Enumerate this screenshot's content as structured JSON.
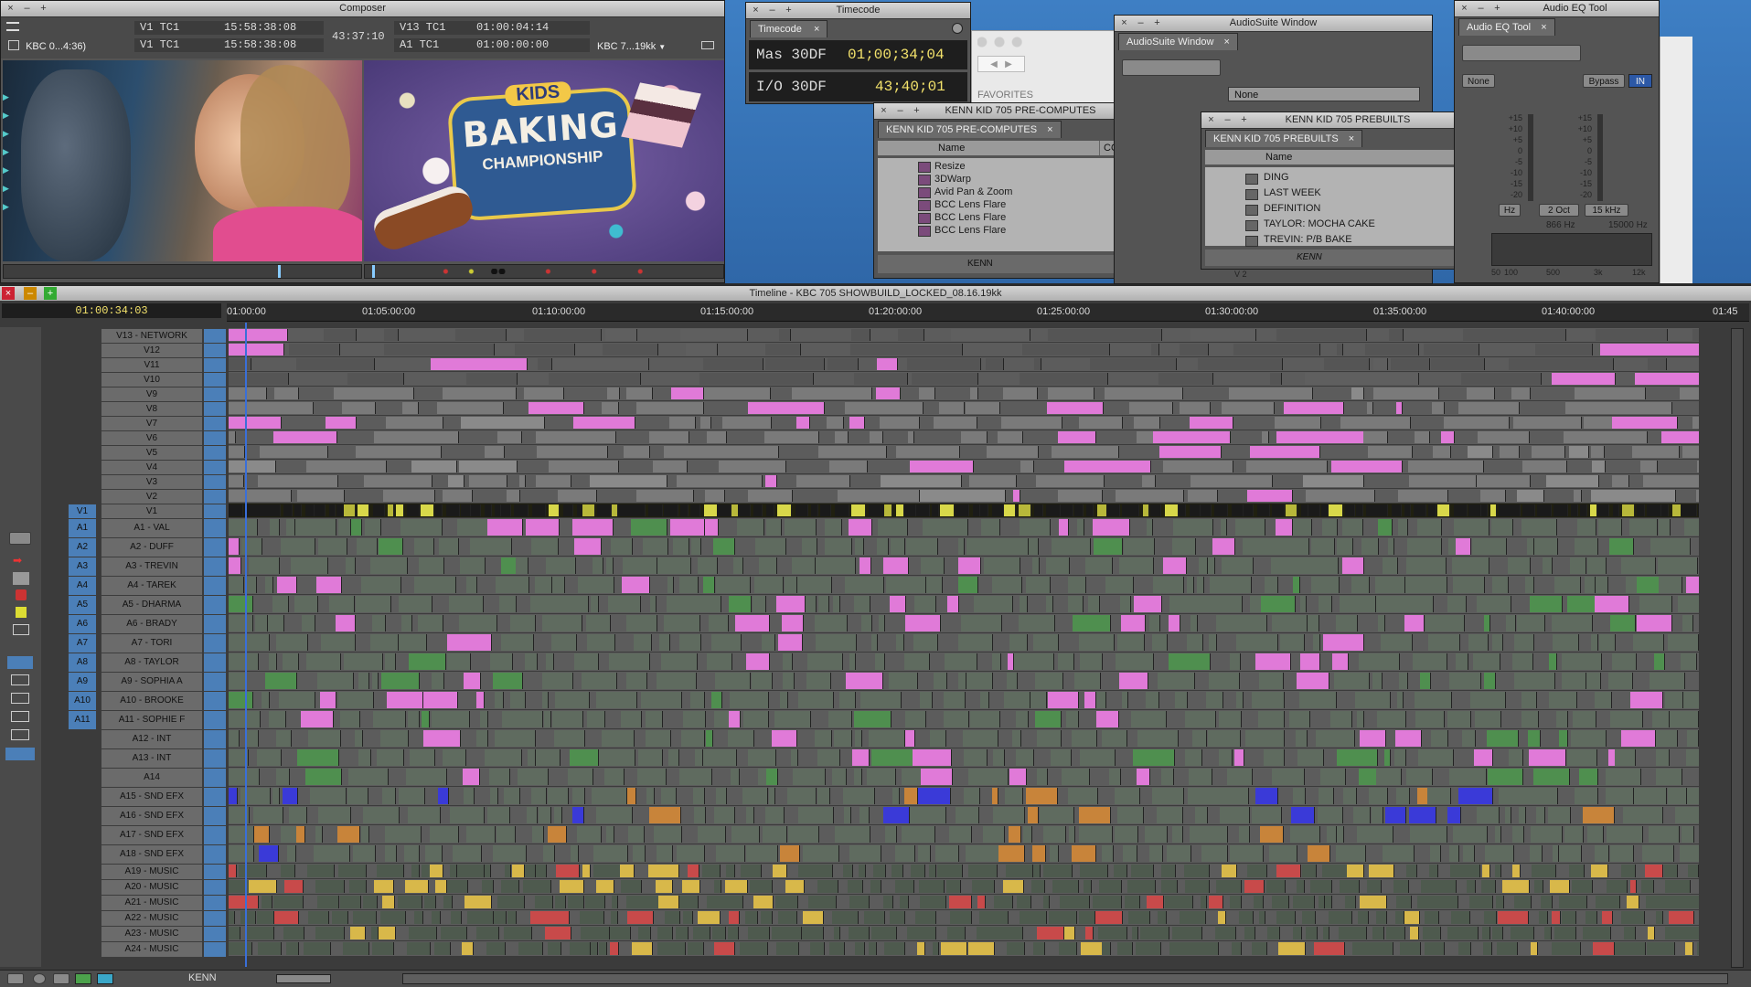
{
  "composer": {
    "title": "Composer",
    "source_clip": "KBC 0...4:36)",
    "tc_rows": [
      {
        "label": "V1  TC1",
        "value": "15:58:38:08"
      },
      {
        "label": "V1  TC1",
        "value": "15:58:38:08"
      }
    ],
    "duration": "43:37:10",
    "tc_rows_right": [
      {
        "label": "V13  TC1",
        "value": "01:00:04:14"
      },
      {
        "label": "A1  TC1",
        "value": "01:00:00:00"
      }
    ],
    "record_clip": "KBC 7...19kk",
    "title_card": {
      "line1": "KIDS",
      "line2": "BAKING",
      "line3": "CHAMPIONSHIP"
    }
  },
  "timecode_window": {
    "title": "Timecode",
    "tab": "Timecode",
    "rows": [
      {
        "label": "Mas 30DF",
        "value": "01;00;34;04 A1."
      },
      {
        "label": "I/O 30DF",
        "value": "43;40;01"
      }
    ]
  },
  "favorites": {
    "label": "FAVORITES"
  },
  "precomputes_bin": {
    "title": "KENN KID 705 PRE-COMPUTES",
    "tab": "KENN KID 705 PRE-COMPUTES",
    "columns": [
      "Name",
      "COMMENTS"
    ],
    "items": [
      "Resize",
      "3DWarp",
      "Avid Pan & Zoom",
      "BCC Lens Flare",
      "BCC Lens Flare",
      "BCC Lens Flare"
    ],
    "footer_label": "KENN"
  },
  "audiosuite": {
    "title": "AudioSuite Window",
    "tab": "AudioSuite Window",
    "plugin_value": "None"
  },
  "prebuilts_bin": {
    "title": "KENN KID 705 PREBUILTS",
    "tab": "KENN KID 705 PREBUILTS",
    "column": "Name",
    "items": [
      "DING",
      "LAST WEEK",
      "DEFINITION",
      "TAYLOR:  MOCHA CAKE",
      "TREVIN:  P/B BAKE"
    ],
    "footer_label": "KENN",
    "track_hint": "V 2"
  },
  "audio_eq": {
    "title": "Audio EQ Tool",
    "tab": "Audio EQ Tool",
    "preset": "None",
    "bypass_label": "Bypass",
    "in_label": "IN",
    "scale_left": [
      "+15",
      "+10",
      "+5",
      "0",
      "-5",
      "-10",
      "-15",
      "-20"
    ],
    "scale_right": [
      "+15",
      "+10",
      "+5",
      "0",
      "-5",
      "-10",
      "-15",
      "-20"
    ],
    "band_buttons": [
      "Hz",
      "2 Oct",
      "15 kHz"
    ],
    "freq_readouts": [
      "866 Hz",
      "15000 Hz"
    ],
    "freq_scale": [
      "50",
      "100",
      "500",
      "3k",
      "12k"
    ]
  },
  "timeline": {
    "title": "Timeline - KBC 705 SHOWBUILD_LOCKED_08.16.19kk",
    "current_tc": "01:00:34:03",
    "ruler": [
      "01:00:00",
      "01:05:00:00",
      "01:10:00:00",
      "01:15:00:00",
      "01:20:00:00",
      "01:25:00:00",
      "01:30:00:00",
      "01:35:00:00",
      "01:40:00:00",
      "01:45"
    ],
    "video_tracks": [
      "V13 - NETWORK",
      "V12",
      "V11",
      "V10",
      "V9",
      "V8",
      "V7",
      "V6",
      "V5",
      "V4",
      "V3",
      "V2",
      "V1"
    ],
    "source_video": "V1",
    "audio_tracks": [
      {
        "src": "A1",
        "name": "A1 - VAL"
      },
      {
        "src": "A2",
        "name": "A2 - DUFF"
      },
      {
        "src": "A3",
        "name": "A3 - TREVIN"
      },
      {
        "src": "A4",
        "name": "A4 - TAREK"
      },
      {
        "src": "A5",
        "name": "A5 - DHARMA"
      },
      {
        "src": "A6",
        "name": "A6 - BRADY"
      },
      {
        "src": "A7",
        "name": "A7 - TORI"
      },
      {
        "src": "A8",
        "name": "A8 - TAYLOR"
      },
      {
        "src": "A9",
        "name": "A9 - SOPHIA A"
      },
      {
        "src": "A10",
        "name": "A10 - BROOKE"
      },
      {
        "src": "A11",
        "name": "A11 - SOPHIE F"
      },
      {
        "src": "",
        "name": "A12 - INT"
      },
      {
        "src": "",
        "name": "A13 - INT"
      },
      {
        "src": "",
        "name": "A14"
      },
      {
        "src": "",
        "name": "A15 - SND EFX"
      },
      {
        "src": "",
        "name": "A16 - SND EFX"
      },
      {
        "src": "",
        "name": "A17 - SND EFX"
      },
      {
        "src": "",
        "name": "A18 - SND EFX"
      },
      {
        "src": "",
        "name": "A19 - MUSIC"
      },
      {
        "src": "",
        "name": "A20 - MUSIC"
      },
      {
        "src": "",
        "name": "A21 - MUSIC"
      },
      {
        "src": "",
        "name": "A22 - MUSIC"
      },
      {
        "src": "",
        "name": "A23 - MUSIC"
      },
      {
        "src": "",
        "name": "A24 - MUSIC"
      }
    ],
    "footer_label": "KENN"
  },
  "colors": {
    "audio_clip": "#5f6b5f",
    "video_clip": "#7a7a7a",
    "clip_accent_pink": "#e07ad8",
    "clip_accent_yellow": "#d8d84a",
    "track_source_blue": "#4b7fb8",
    "timeline_bg": "#3b3b3b"
  }
}
